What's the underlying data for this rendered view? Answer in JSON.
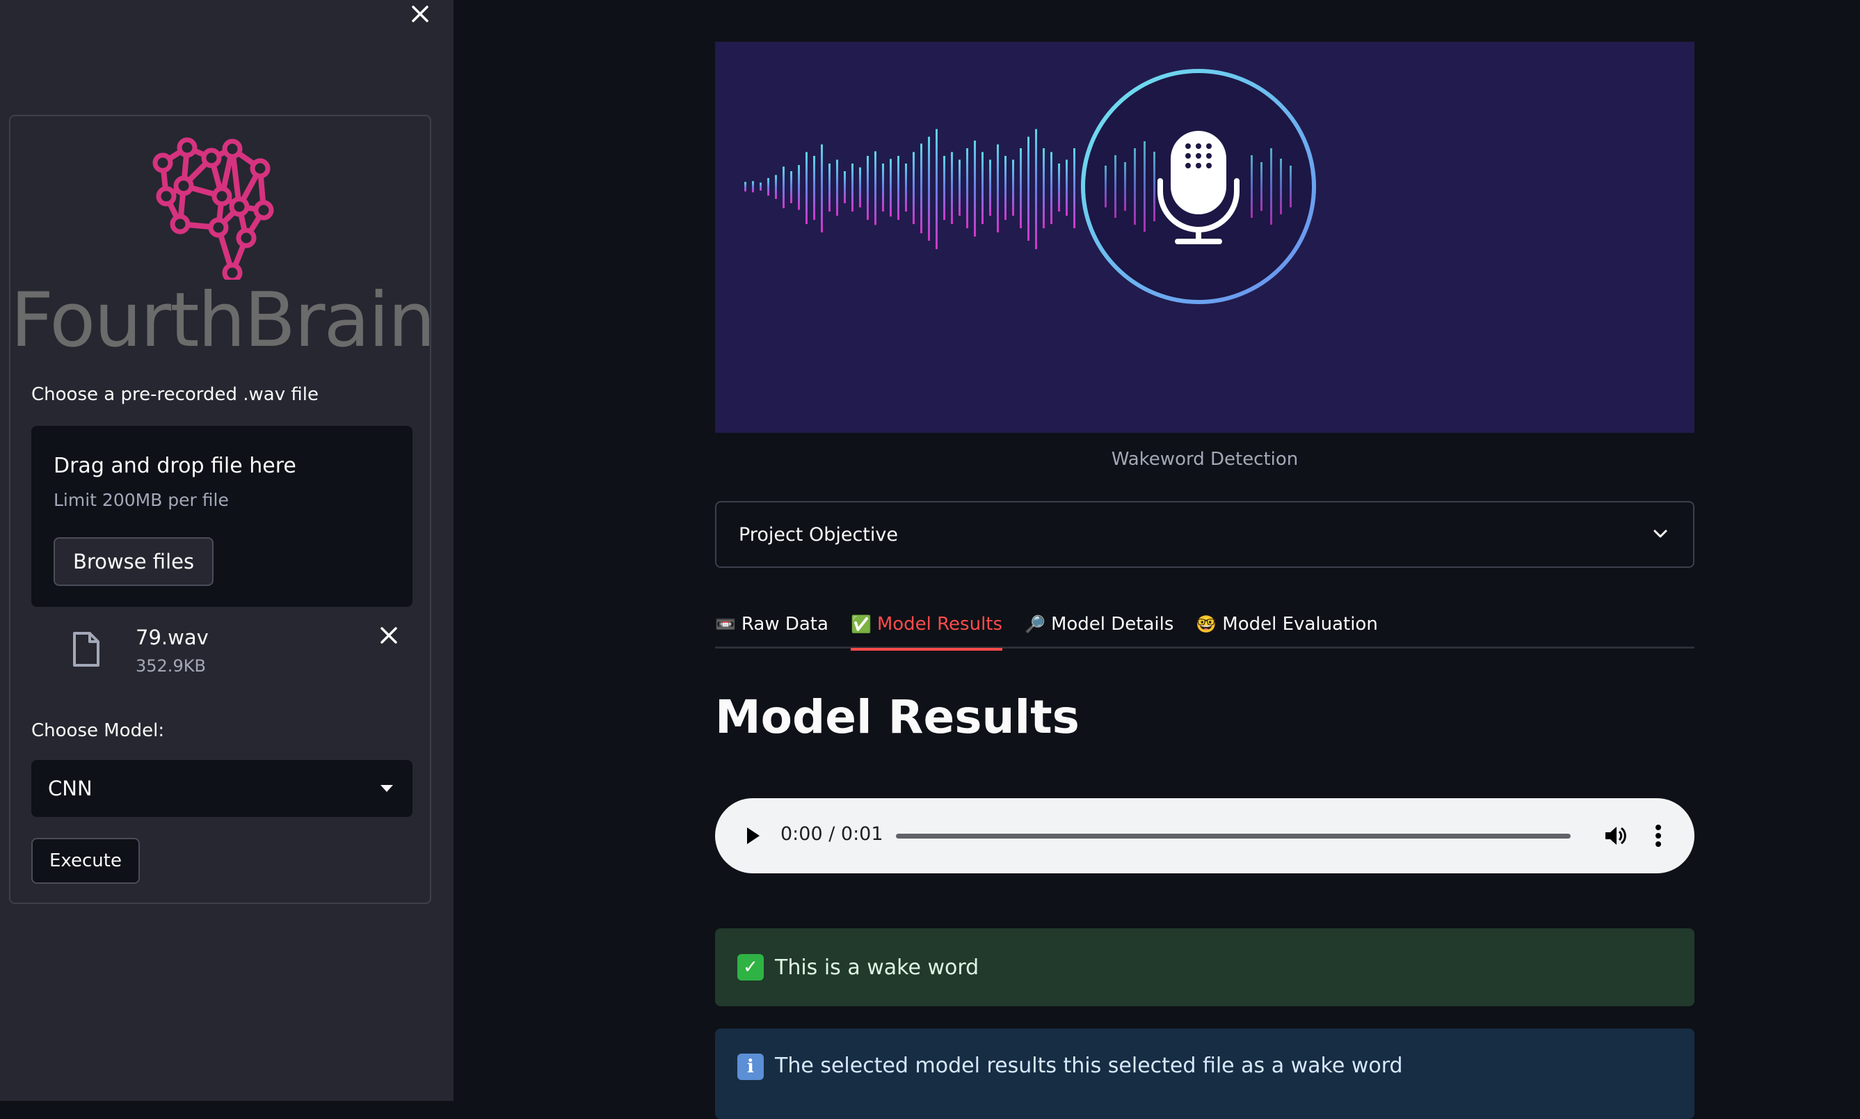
{
  "sidebar": {
    "logo_text": "FourthBrain",
    "upload_label": "Choose a pre-recorded .wav file",
    "uploader_title": "Drag and drop file here",
    "uploader_limit": "Limit 200MB per file",
    "browse_label": "Browse files",
    "file": {
      "name": "79.wav",
      "size": "352.9KB"
    },
    "model_label": "Choose Model:",
    "model_selected": "CNN",
    "execute_label": "Execute"
  },
  "main": {
    "banner_caption": "Wakeword Detection",
    "expander_label": "Project Objective",
    "tabs": [
      {
        "emoji": "📼",
        "label": "Raw Data"
      },
      {
        "emoji": "✅",
        "label": "Model Results"
      },
      {
        "emoji": "🔎",
        "label": "Model Details"
      },
      {
        "emoji": "🤓",
        "label": "Model Evaluation"
      }
    ],
    "active_tab": "Model Results",
    "page_title": "Model Results",
    "audio": {
      "time": "0:00 / 0:01",
      "progress": 0
    },
    "success_text": "This is a wake word",
    "info_text": "The selected model results this selected file as a wake word"
  },
  "colors": {
    "accent": "#ff4b4b",
    "sidebar_bg": "#262730",
    "app_bg": "#0e1117",
    "logo_pink": "#d6337f",
    "success_bg": "#213a2c",
    "info_bg": "#172d43"
  }
}
